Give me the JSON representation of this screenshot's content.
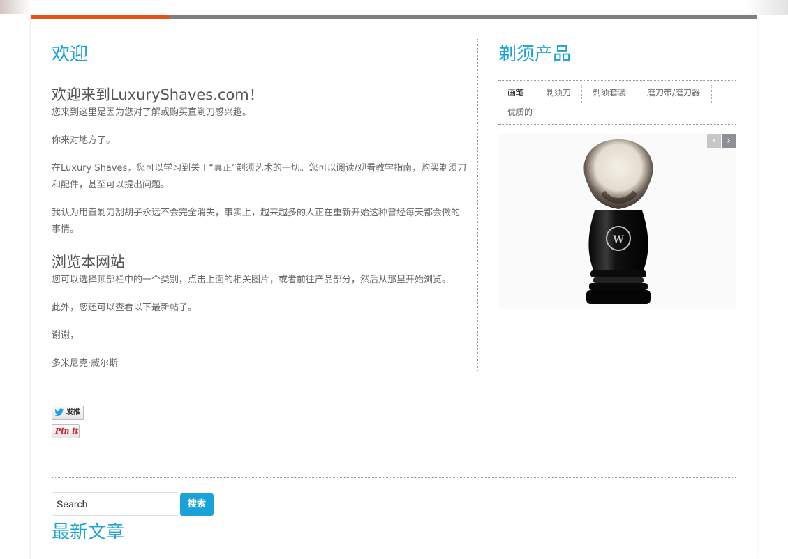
{
  "main": {
    "title": "欢迎",
    "welcome_heading": "欢迎来到LuxuryShaves.com！",
    "paragraphs": [
      "您来到这里是因为您对了解或购买直剃刀感兴趣。",
      "你来对地方了。",
      "在Luxury Shaves，您可以学习到关于“真正”剃须艺术的一切。您可以阅读/观看教学指南，购买剃须刀和配件，甚至可以提出问题。",
      "我认为用直剃刀刮胡子永远不会完全消失，事实上，越来越多的人正在重新开始这种曾经每天都会做的事情。"
    ],
    "browse_heading": "浏览本网站",
    "browse_paragraphs": [
      "您可以选择顶部栏中的一个类别，点击上面的相关图片，或者前往产品部分，然后从那里开始浏览。",
      "此外，您还可以查看以下最新帖子。",
      "谢谢，",
      "多米尼克·威尔斯"
    ],
    "tweet_label": "发推",
    "pinit_label": "Pin it"
  },
  "sidebar": {
    "title": "剃须产品",
    "tabs": [
      {
        "label": "画笔",
        "active": true
      },
      {
        "label": "剃须刀",
        "active": false
      },
      {
        "label": "剃须套装",
        "active": false
      },
      {
        "label": "磨刀带/磨刀器",
        "active": false
      },
      {
        "label": "优质的",
        "active": false
      }
    ],
    "prev_icon": "‹",
    "next_icon": "›"
  },
  "search": {
    "value": "Search",
    "button_label": "搜索"
  },
  "latest_heading": "最新文章",
  "colors": {
    "accent_blue": "#1ba2d8",
    "accent_orange": "#e3541b",
    "topbar_gray": "#7c8084"
  }
}
